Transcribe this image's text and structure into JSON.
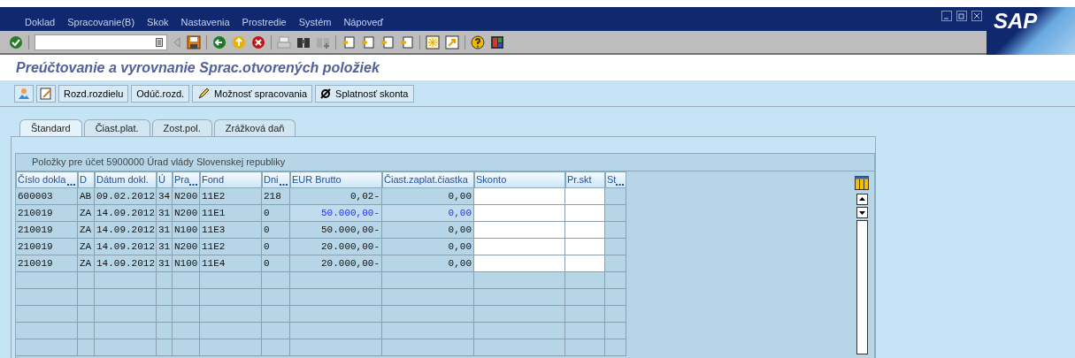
{
  "menu_bar": {
    "items": [
      "Doklad",
      "Spracovanie(B)",
      "Skok",
      "Nastavenia",
      "Prostredie",
      "Systém",
      "Nápoveď"
    ],
    "logo": "SAP"
  },
  "screen_title": "Preúčtovanie a vyrovnanie Sprac.otvorených položiek",
  "app_toolbar": {
    "buttons": [
      {
        "label": "Rozd.rozdielu",
        "kind": "text"
      },
      {
        "label": "Odúč.rozd.",
        "kind": "text"
      },
      {
        "label": "Možnosť spracovania",
        "kind": "pencil"
      },
      {
        "label": "Splatnosť skonta",
        "kind": "symbol"
      }
    ]
  },
  "tabs": [
    {
      "label": "Štandard",
      "selected": true
    },
    {
      "label": "Čiast.plat.",
      "selected": false
    },
    {
      "label": "Zost.pol.",
      "selected": false
    },
    {
      "label": "Zrážková daň",
      "selected": false
    }
  ],
  "table": {
    "title": "Položky pre účet 5900000 Úrad vlády Slovenskej republiky",
    "columns": [
      {
        "label": "Číslo dokla",
        "truncated": true
      },
      {
        "label": "D",
        "truncated": false
      },
      {
        "label": "Dátum dokl.",
        "truncated": false
      },
      {
        "label": "Ú",
        "truncated": false
      },
      {
        "label": "Pra",
        "truncated": true
      },
      {
        "label": "Fond",
        "truncated": false
      },
      {
        "label": "Dni",
        "truncated": true
      },
      {
        "label": "EUR Brutto",
        "truncated": false
      },
      {
        "label": "Čiast.zaplat.čiastka",
        "truncated": false
      },
      {
        "label": "Skonto",
        "truncated": false
      },
      {
        "label": "Pr.skt",
        "truncated": false
      },
      {
        "label": "St",
        "truncated": true
      }
    ],
    "rows": [
      {
        "cells": [
          "600003",
          "AB",
          "09.02.2012",
          "34",
          "N200",
          "11E2",
          "218",
          "0,02-",
          "0,00"
        ],
        "selected": false
      },
      {
        "cells": [
          "210019",
          "ZA",
          "14.09.2012",
          "31",
          "N200",
          "11E1",
          "0",
          "50.000,00-",
          "0,00"
        ],
        "selected": true
      },
      {
        "cells": [
          "210019",
          "ZA",
          "14.09.2012",
          "31",
          "N100",
          "11E3",
          "0",
          "50.000,00-",
          "0,00"
        ],
        "selected": false
      },
      {
        "cells": [
          "210019",
          "ZA",
          "14.09.2012",
          "31",
          "N200",
          "11E2",
          "0",
          "20.000,00-",
          "0,00"
        ],
        "selected": false
      },
      {
        "cells": [
          "210019",
          "ZA",
          "14.09.2012",
          "31",
          "N100",
          "11E4",
          "0",
          "20.000,00-",
          "0,00"
        ],
        "selected": false
      }
    ]
  }
}
